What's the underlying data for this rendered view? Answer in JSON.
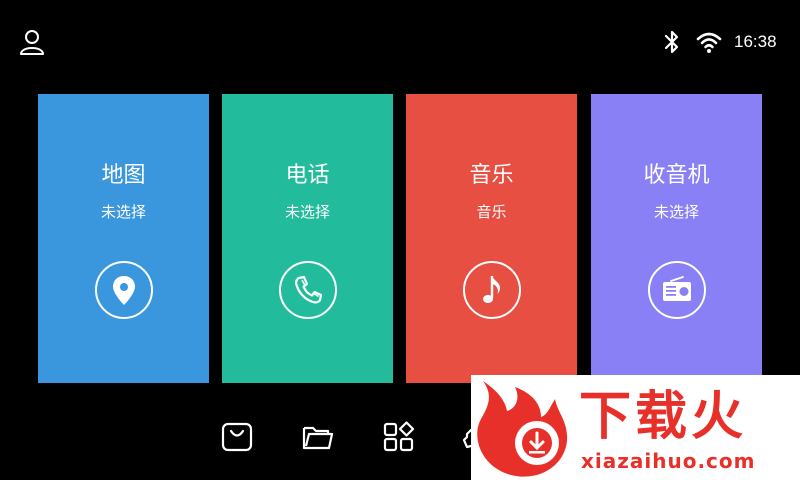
{
  "status_bar": {
    "time": "16:38",
    "icons": [
      "user-icon",
      "bluetooth-icon",
      "wifi-icon"
    ]
  },
  "cards": [
    {
      "title": "地图",
      "subtitle": "未选择",
      "icon": "location-pin-icon",
      "color": "#3a97de"
    },
    {
      "title": "电话",
      "subtitle": "未选择",
      "icon": "phone-icon",
      "color": "#22bc9c"
    },
    {
      "title": "音乐",
      "subtitle": "音乐",
      "icon": "music-note-icon",
      "color": "#e64f42"
    },
    {
      "title": "收音机",
      "subtitle": "未选择",
      "icon": "radio-icon",
      "color": "#8a80f5"
    }
  ],
  "dock": {
    "icons": [
      "shopping-bag-icon",
      "folder-icon",
      "apps-grid-icon",
      "settings-icon",
      "car-icon"
    ]
  },
  "watermark": {
    "text": "下载火",
    "url": "xiazaihuo.com",
    "color": "#e8302a"
  }
}
